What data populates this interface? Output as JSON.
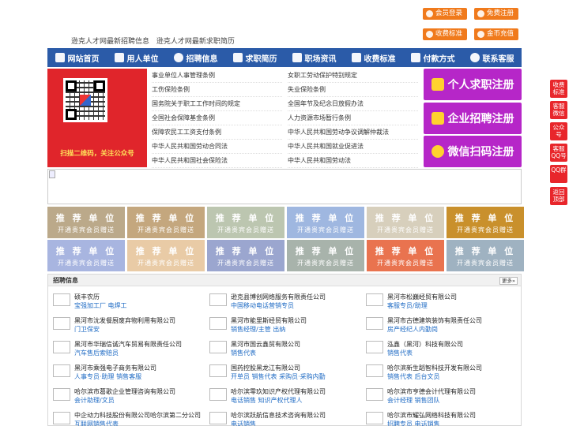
{
  "header": {
    "links": [
      "逊克人才网最新招聘信息",
      "逊克人才网最新求职简历"
    ],
    "buttons": {
      "login": "会员登录",
      "register": "免费注册",
      "pricing": "收费标准",
      "recharge": "金币充值"
    }
  },
  "nav": [
    {
      "label": "网站首页",
      "icon": "home-icon"
    },
    {
      "label": "用人单位",
      "icon": "building-icon"
    },
    {
      "label": "招聘信息",
      "icon": "recruit-icon"
    },
    {
      "label": "求职简历",
      "icon": "resume-icon"
    },
    {
      "label": "职场资讯",
      "icon": "news-icon"
    },
    {
      "label": "收费标准",
      "icon": "price-icon"
    },
    {
      "label": "付款方式",
      "icon": "payment-icon"
    },
    {
      "label": "联系客服",
      "icon": "service-icon"
    }
  ],
  "banner": {
    "qr_caption": "扫描二维码，关注公众号",
    "laws_left": [
      "事业单位人事管理条例",
      "工伤保险条例",
      "国务院关于职工工作时间的规定",
      "全国社会保障基金条例",
      "保障农民工工资支付条例",
      "中华人民共和国劳动合同法",
      "中华人民共和国社会保险法"
    ],
    "laws_right": [
      "女职工劳动保护特别规定",
      "失业保险条例",
      "全国年节及纪念日放假办法",
      "人力资源市场暂行条例",
      "中华人民共和国劳动争议调解仲裁法",
      "中华人民共和国就业促进法",
      "中华人民共和国劳动法"
    ],
    "register_buttons": [
      "个人求职注册",
      "企业招聘注册",
      "微信扫码注册"
    ]
  },
  "recommended": {
    "title": "推 荐 单 位",
    "subtitle": "开通贵宾会员赠送",
    "colors": [
      "#bba98a",
      "#c4a77e",
      "#bcc6b0",
      "#9fb7e0",
      "#d7cfbc",
      "#c9902c",
      "#a8b5e0",
      "#e9cba6",
      "#9ba6cf",
      "#a8b3ab",
      "#e9734f",
      "#9fb2c1"
    ]
  },
  "recruit": {
    "title": "招聘信息",
    "more": "更多»",
    "items": [
      {
        "company": "硕丰农历",
        "position": "宝强加工厂 电焊工"
      },
      {
        "company": "逊克县博创网络服务有限责任公司",
        "position": "中国移动电话营销专员"
      },
      {
        "company": "黑河市松巍经贸有限公司",
        "position": "客服专员/助理"
      },
      {
        "company": "黑河市沈发餐厨废弃物利用有限公司",
        "position": "门卫保安"
      },
      {
        "company": "黑河市能里斯经贸有限公司",
        "position": "销售经理/主管 出纳"
      },
      {
        "company": "黑河市古德建筑装饰有限责任公司",
        "position": "房产经纪人内勤岗"
      },
      {
        "company": "黑河市华瑞信诚汽车贸易有限责任公司",
        "position": "汽车售后索赔员"
      },
      {
        "company": "黑河市国云鑫贸有限公司",
        "position": "销售代表"
      },
      {
        "company": "泓鑫（黑河）科技有限公司",
        "position": "销售代表"
      },
      {
        "company": "黑河市乘强电子商务有限公司",
        "position": "人事专员·助理 销售客服"
      },
      {
        "company": "国药控股黑龙江有限公司",
        "position": "开单员 销售代表 采购员·采购内勤"
      },
      {
        "company": "哈尔滨新生蹈智科技开发有限公司",
        "position": "销售代表 后台文员"
      },
      {
        "company": "哈尔滨市葛歌企业管理咨询有限公司",
        "position": "会计助理/文员"
      },
      {
        "company": "哈尔滨零玖知识产权代理有限公司",
        "position": "电话销售 知识产权代理人"
      },
      {
        "company": "哈尔滨市亨德会计代理有限公司",
        "position": "会计经理 销售团队"
      },
      {
        "company": "中企动力科技股份有限公司哈尔滨第二分公司",
        "position": "互联网销售代表"
      },
      {
        "company": "哈尔滨跃航信息技术咨询有限公司",
        "position": "电话销售"
      },
      {
        "company": "哈尔滨市耀弘网络科技有限公司",
        "position": "招聘专员 电话销售"
      }
    ]
  },
  "side": [
    "收费标准",
    "客服微信",
    "公众号",
    "客服QQ号",
    "QQ群",
    "返回顶部"
  ]
}
